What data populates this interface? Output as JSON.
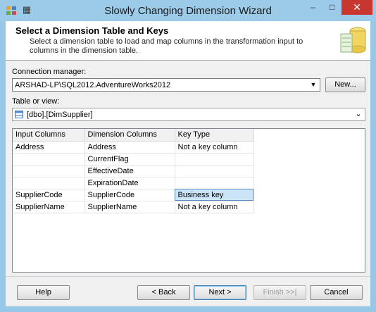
{
  "window": {
    "title": "Slowly Changing Dimension Wizard",
    "controls": {
      "minimize": "–",
      "maximize": "□",
      "close": "✕"
    }
  },
  "header": {
    "title": "Select a Dimension Table and Keys",
    "description": "Select a dimension table to load and map columns in the transformation input to columns in the dimension table."
  },
  "connection": {
    "label": "Connection manager:",
    "value": "ARSHAD-LP\\SQL2012.AdventureWorks2012",
    "new_button": "New..."
  },
  "table_view": {
    "label": "Table or view:",
    "value": "[dbo].[DimSupplier]"
  },
  "grid": {
    "columns": [
      "Input Columns",
      "Dimension Columns",
      "Key Type"
    ],
    "rows": [
      [
        "Address",
        "Address",
        "Not a key column"
      ],
      [
        "",
        "CurrentFlag",
        ""
      ],
      [
        "",
        "EffectiveDate",
        ""
      ],
      [
        "",
        "ExpirationDate",
        ""
      ],
      [
        "SupplierCode",
        "SupplierCode",
        "Business key"
      ],
      [
        "SupplierName",
        "SupplierName",
        "Not a key column"
      ]
    ],
    "selected_row": 4
  },
  "footer": {
    "help": "Help",
    "back": "< Back",
    "next": "Next >",
    "finish": "Finish >>|",
    "cancel": "Cancel"
  },
  "colors": {
    "titlebar": "#9ccbe9",
    "close": "#c7372f",
    "selection": "#cce4f7"
  }
}
